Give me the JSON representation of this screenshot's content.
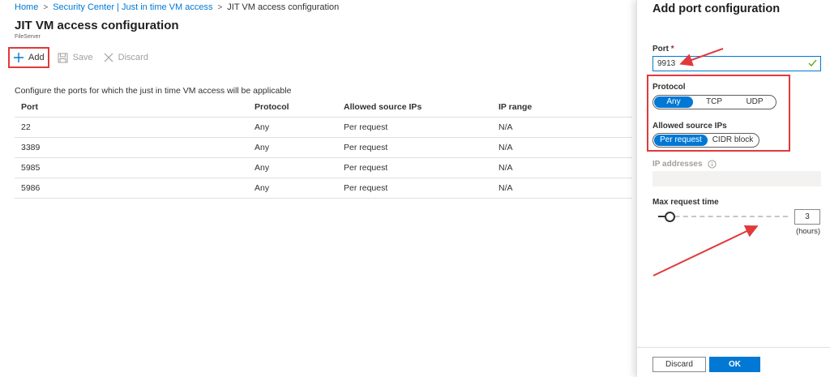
{
  "breadcrumb": {
    "items": [
      "Home",
      "Security Center | Just in time VM access",
      "JIT VM access configuration"
    ]
  },
  "page": {
    "title": "JIT VM access configuration",
    "subtitle": "FileServer"
  },
  "toolbar": {
    "add_label": "Add",
    "save_label": "Save",
    "discard_label": "Discard"
  },
  "main": {
    "intro": "Configure the ports for which the just in time VM access will be applicable",
    "columns": [
      "Port",
      "Protocol",
      "Allowed source IPs",
      "IP range"
    ],
    "rows": [
      [
        "22",
        "Any",
        "Per request",
        "N/A"
      ],
      [
        "3389",
        "Any",
        "Per request",
        "N/A"
      ],
      [
        "5985",
        "Any",
        "Per request",
        "N/A"
      ],
      [
        "5986",
        "Any",
        "Per request",
        "N/A"
      ]
    ]
  },
  "blade": {
    "title": "Add port configuration",
    "port_label": "Port",
    "port_required_mark": "*",
    "port_value": "9913",
    "protocol_label": "Protocol",
    "protocol_options": [
      "Any",
      "TCP",
      "UDP"
    ],
    "protocol_selected": "Any",
    "source_label": "Allowed source IPs",
    "source_options": [
      "Per request",
      "CIDR block"
    ],
    "source_selected": "Per request",
    "ip_label": "IP addresses",
    "max_time_label": "Max request time",
    "max_time_value": "3",
    "max_time_unit": "(hours)",
    "discard_label": "Discard",
    "ok_label": "OK"
  },
  "colors": {
    "accent": "#0078d4",
    "highlight": "#e03a3a",
    "text": "#323130"
  }
}
